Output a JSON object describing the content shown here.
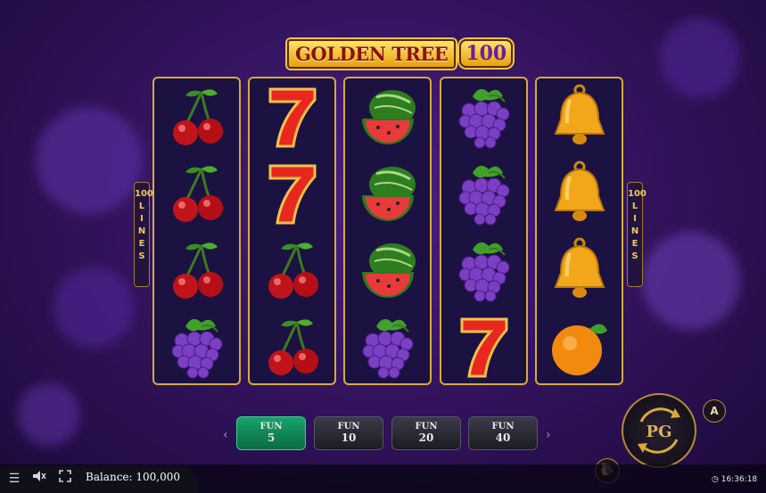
{
  "game": {
    "title_main": "GOLDEN TREE",
    "title_num": "100"
  },
  "side_lines": {
    "count": "100",
    "word": "LINES"
  },
  "reels": [
    [
      "cherries",
      "cherries",
      "cherries",
      "grapes"
    ],
    [
      "seven",
      "seven",
      "cherries",
      "cherries"
    ],
    [
      "watermelon",
      "watermelon",
      "watermelon",
      "grapes"
    ],
    [
      "grapes",
      "grapes",
      "grapes",
      "seven"
    ],
    [
      "bell",
      "bell",
      "bell",
      "orange"
    ]
  ],
  "bets": [
    {
      "label": "FUN",
      "value": "5",
      "active": true
    },
    {
      "label": "FUN",
      "value": "10",
      "active": false
    },
    {
      "label": "FUN",
      "value": "20",
      "active": false
    },
    {
      "label": "FUN",
      "value": "40",
      "active": false
    }
  ],
  "controls": {
    "auto_label": "A"
  },
  "bottom_bar": {
    "balance_label": "Balance:",
    "balance_value": "100,000",
    "clock": "16:36:18"
  }
}
